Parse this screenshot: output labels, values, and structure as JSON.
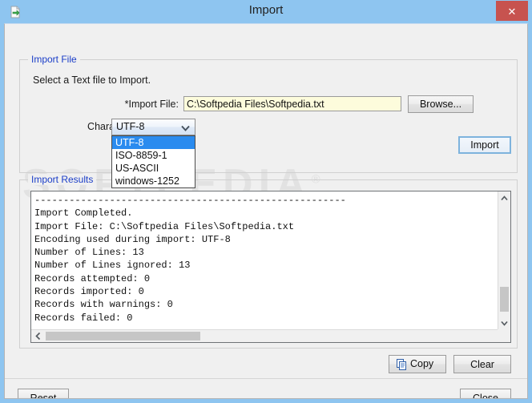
{
  "window": {
    "title": "Import",
    "icon": "import-document-icon",
    "close_label": "✕",
    "frame_color": "#8ec5f0",
    "client_bg": "#f0f0f0"
  },
  "watermark": {
    "text": "SOFTPEDIA",
    "registered_mark": "®"
  },
  "import_file_group": {
    "label": "Import File",
    "hint": "Select a Text file to Import.",
    "import_file_label": "*Import File:",
    "import_file_value": "C:\\Softpedia Files\\Softpedia.txt",
    "import_file_placeholder": "",
    "browse_label": "Browse...",
    "char_encoding_label": "Character Encoding:",
    "char_encoding_value": "UTF-8",
    "char_encoding_options": [
      "UTF-8",
      "ISO-8859-1",
      "US-ASCII",
      "windows-1252"
    ],
    "char_encoding_selected_index": 0,
    "import_button_label": "Import"
  },
  "import_results_group": {
    "label": "Import Results",
    "results_text": "------------------------------------------------------\nImport Completed.\nImport File: C:\\Softpedia Files\\Softpedia.txt\nEncoding used during import: UTF-8\nNumber of Lines: 13\nNumber of Lines ignored: 13\nRecords attempted: 0\nRecords imported: 0\nRecords with warnings: 0\nRecords failed: 0",
    "copy_label": "Copy",
    "clear_label": "Clear",
    "scroll": {
      "vertical_arrow_up": "˄",
      "vertical_arrow_down": "˅",
      "horizontal_arrow_left": "‹",
      "horizontal_arrow_right": "›"
    }
  },
  "footer": {
    "reset_label": "Reset",
    "close_label": "Close"
  },
  "colors": {
    "title_bar": "#8ec5f0",
    "close_button": "#c7534f",
    "group_label": "#1b3ec8",
    "input_background": "#fdfcdc",
    "highlight": "#2a8bef",
    "focus_border": "#7eb3dd"
  }
}
